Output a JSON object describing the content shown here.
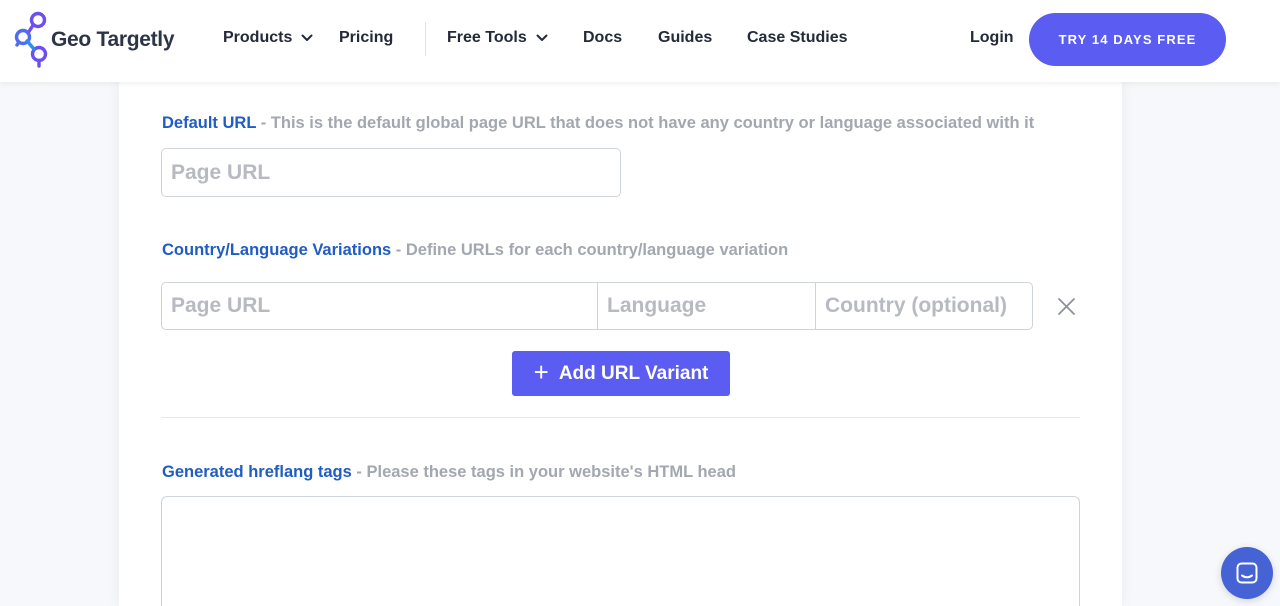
{
  "brand": {
    "name": "Geo Targetly",
    "accent": "#5a5cf2",
    "logo_color": "#6b4ff0",
    "logo_color_2": "#2d8cf0"
  },
  "nav": {
    "products": "Products",
    "pricing": "Pricing",
    "free_tools": "Free Tools",
    "docs": "Docs",
    "guides": "Guides",
    "case_studies": "Case Studies",
    "login": "Login",
    "cta": "TRY 14 DAYS FREE"
  },
  "default_url": {
    "label": "Default URL",
    "description": " - This is the default global page URL that does not have any country or language associated with it",
    "placeholder": "Page URL"
  },
  "variations": {
    "label": "Country/Language Variations",
    "description": " - Define URLs for each country/language variation",
    "row": {
      "page_url_placeholder": "Page URL",
      "language_placeholder": "Language",
      "country_placeholder": "Country (optional)"
    },
    "add_button": "Add URL Variant",
    "add_icon": "+"
  },
  "output": {
    "label": "Generated hreflang tags",
    "description": " - Please these tags in your website's HTML head"
  },
  "icons": {
    "chevron": "chevron-down-icon",
    "remove": "close-icon",
    "chat": "chat-icon"
  }
}
